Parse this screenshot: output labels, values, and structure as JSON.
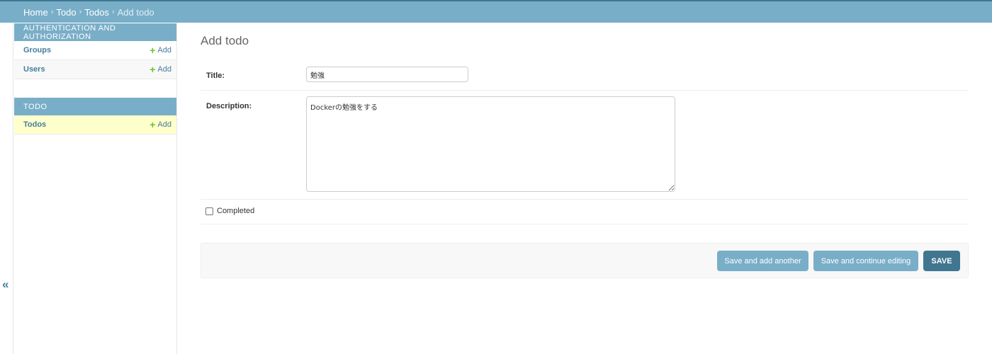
{
  "breadcrumbs": {
    "home": "Home",
    "app": "Todo",
    "model": "Todos",
    "current": "Add todo",
    "separator": "›"
  },
  "sidebar": {
    "modules": [
      {
        "caption": "AUTHENTICATION AND AUTHORIZATION",
        "models": [
          {
            "name": "Groups",
            "add_label": "Add"
          },
          {
            "name": "Users",
            "add_label": "Add"
          }
        ]
      },
      {
        "caption": "TODO",
        "models": [
          {
            "name": "Todos",
            "add_label": "Add"
          }
        ]
      }
    ],
    "collapse_icon": "«"
  },
  "content": {
    "title": "Add todo",
    "fields": {
      "title_label": "Title:",
      "title_value": "勉強",
      "description_label": "Description:",
      "description_value": "Dockerの勉強をする",
      "completed_label": "Completed",
      "completed_checked": false
    },
    "buttons": {
      "save_add_another": "Save and add another",
      "save_continue": "Save and continue editing",
      "save": "SAVE"
    }
  },
  "colors": {
    "header": "#79aec8",
    "primary_button": "#417690",
    "link": "#447e9b",
    "add_icon": "#70bf2b",
    "selected_row": "#ffffcc"
  }
}
